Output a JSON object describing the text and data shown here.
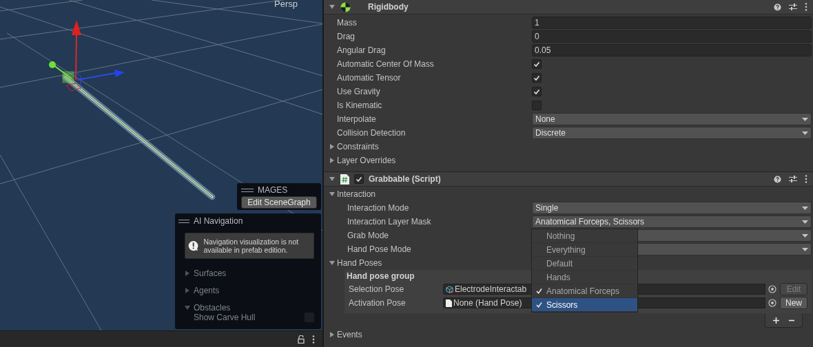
{
  "scene": {
    "view_label": "Persp"
  },
  "mages_panel": {
    "title": "MAGES",
    "button": "Edit SceneGraph"
  },
  "ai_navigation": {
    "title": "AI Navigation",
    "message": "Navigation visualization is not available in prefab edition.",
    "sections": [
      {
        "label": "Surfaces",
        "expanded": false
      },
      {
        "label": "Agents",
        "expanded": false
      },
      {
        "label": "Obstacles",
        "expanded": true
      }
    ],
    "show_carve_hull": {
      "label": "Show Carve Hull",
      "checked": false
    }
  },
  "rigidbody": {
    "title": "Rigidbody",
    "expanded": true,
    "fields": [
      {
        "kind": "number",
        "label": "Mass",
        "value": "1"
      },
      {
        "kind": "number",
        "label": "Drag",
        "value": "0"
      },
      {
        "kind": "number",
        "label": "Angular Drag",
        "value": "0.05"
      },
      {
        "kind": "checkbox",
        "label": "Automatic Center Of Mass",
        "checked": true
      },
      {
        "kind": "checkbox",
        "label": "Automatic Tensor",
        "checked": true
      },
      {
        "kind": "checkbox",
        "label": "Use Gravity",
        "checked": true
      },
      {
        "kind": "checkbox",
        "label": "Is Kinematic",
        "checked": false
      },
      {
        "kind": "dropdown",
        "label": "Interpolate",
        "value": "None"
      },
      {
        "kind": "dropdown",
        "label": "Collision Detection",
        "value": "Discrete"
      },
      {
        "kind": "foldout",
        "label": "Constraints",
        "expanded": false
      },
      {
        "kind": "foldout",
        "label": "Layer Overrides",
        "expanded": false
      }
    ]
  },
  "grabbable": {
    "title": "Grabbable (Script)",
    "expanded": true,
    "enabled": true,
    "interaction": {
      "label": "Interaction",
      "expanded": true,
      "fields": [
        {
          "kind": "dropdown",
          "label": "Interaction Mode",
          "value": "Single"
        },
        {
          "kind": "dropdown",
          "label": "Interaction Layer Mask",
          "value": "Anatomical Forceps, Scissors"
        },
        {
          "kind": "dropdown",
          "label": "Grab Mode"
        },
        {
          "kind": "dropdown",
          "label": "Hand Pose Mode"
        }
      ]
    },
    "hand_poses": {
      "label": "Hand Poses",
      "expanded": true,
      "group_title": "Hand pose group",
      "rows": [
        {
          "label": "Selection Pose",
          "kind": "prefab",
          "value": "ElectrodeInteractab",
          "button": "Edit",
          "button_disabled": true
        },
        {
          "label": "Activation Pose",
          "kind": "file",
          "value": "None (Hand Pose)",
          "button": "New",
          "button_disabled": false
        }
      ]
    },
    "events": {
      "label": "Events",
      "expanded": false
    }
  },
  "layer_mask_menu": {
    "items": [
      {
        "label": "Nothing",
        "checked": false,
        "selected": false
      },
      {
        "label": "Everything",
        "checked": false,
        "selected": false
      },
      {
        "label": "Default",
        "checked": false,
        "selected": false
      },
      {
        "label": "Hands",
        "checked": false,
        "selected": false
      },
      {
        "label": "Anatomical Forceps",
        "checked": true,
        "selected": false
      },
      {
        "label": "Scissors",
        "checked": true,
        "selected": true
      }
    ]
  }
}
